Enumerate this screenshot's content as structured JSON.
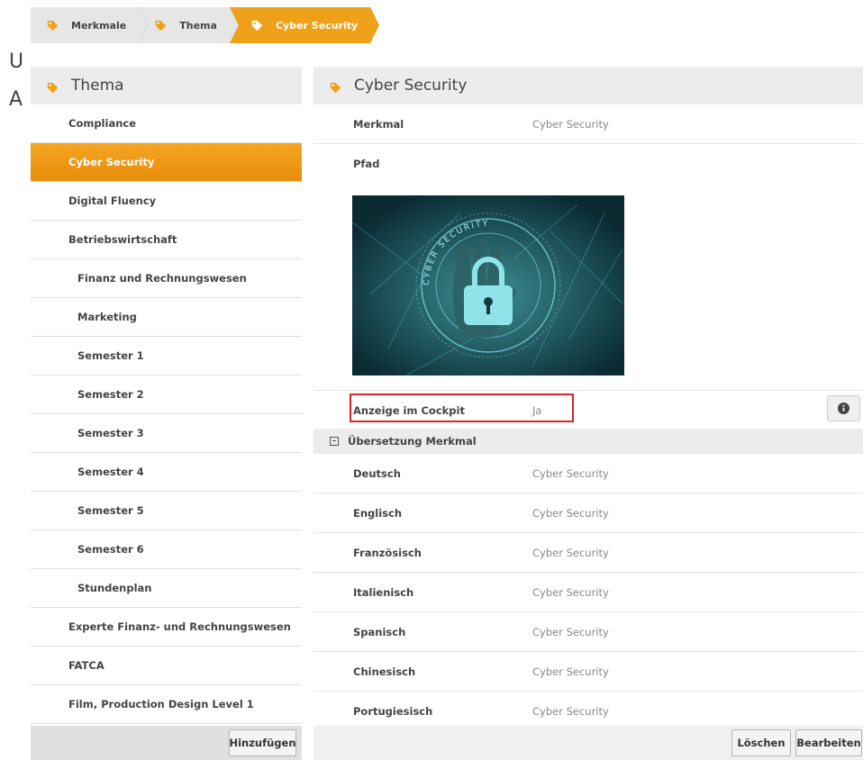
{
  "background": {
    "line1": "U",
    "line2": "A"
  },
  "breadcrumb": [
    {
      "label": "Merkmale"
    },
    {
      "label": "Thema"
    },
    {
      "label": "Cyber Security"
    }
  ],
  "colors": {
    "accent": "#f0a11a",
    "highlight": "#d9242a"
  },
  "left_panel": {
    "title": "Thema",
    "items": [
      {
        "label": "Compliance",
        "level": 0
      },
      {
        "label": "Cyber Security",
        "level": 0,
        "active": true
      },
      {
        "label": "Digital Fluency",
        "level": 0
      },
      {
        "label": "Betriebswirtschaft",
        "level": 0
      },
      {
        "label": "Finanz und Rechnungswesen",
        "level": 1
      },
      {
        "label": "Marketing",
        "level": 1
      },
      {
        "label": "Semester 1",
        "level": 1
      },
      {
        "label": "Semester 2",
        "level": 1
      },
      {
        "label": "Semester 3",
        "level": 1
      },
      {
        "label": "Semester 4",
        "level": 1
      },
      {
        "label": "Semester 5",
        "level": 1
      },
      {
        "label": "Semester 6",
        "level": 1
      },
      {
        "label": "Stundenplan",
        "level": 1
      },
      {
        "label": "Experte Finanz- und Rechnungswesen",
        "level": 0
      },
      {
        "label": "FATCA",
        "level": 0
      },
      {
        "label": "Film, Production Design Level 1",
        "level": 0
      }
    ],
    "add_button": "Hinzufügen"
  },
  "right_panel": {
    "title": "Cyber Security",
    "merkmal_label": "Merkmal",
    "merkmal_value": "Cyber Security",
    "pfad_label": "Pfad",
    "image_text": "CYBER SECURITY",
    "cockpit_label": "Anzeige im Cockpit",
    "cockpit_value": "Ja",
    "translation_section": "Übersetzung Merkmal",
    "translations": [
      {
        "lang": "Deutsch",
        "value": "Cyber Security"
      },
      {
        "lang": "Englisch",
        "value": "Cyber Security"
      },
      {
        "lang": "Französisch",
        "value": "Cyber Security"
      },
      {
        "lang": "Italienisch",
        "value": "Cyber Security"
      },
      {
        "lang": "Spanisch",
        "value": "Cyber Security"
      },
      {
        "lang": "Chinesisch",
        "value": "Cyber Security"
      },
      {
        "lang": "Portugiesisch",
        "value": "Cyber Security"
      }
    ],
    "delete_button": "Löschen",
    "edit_button": "Bearbeiten"
  }
}
